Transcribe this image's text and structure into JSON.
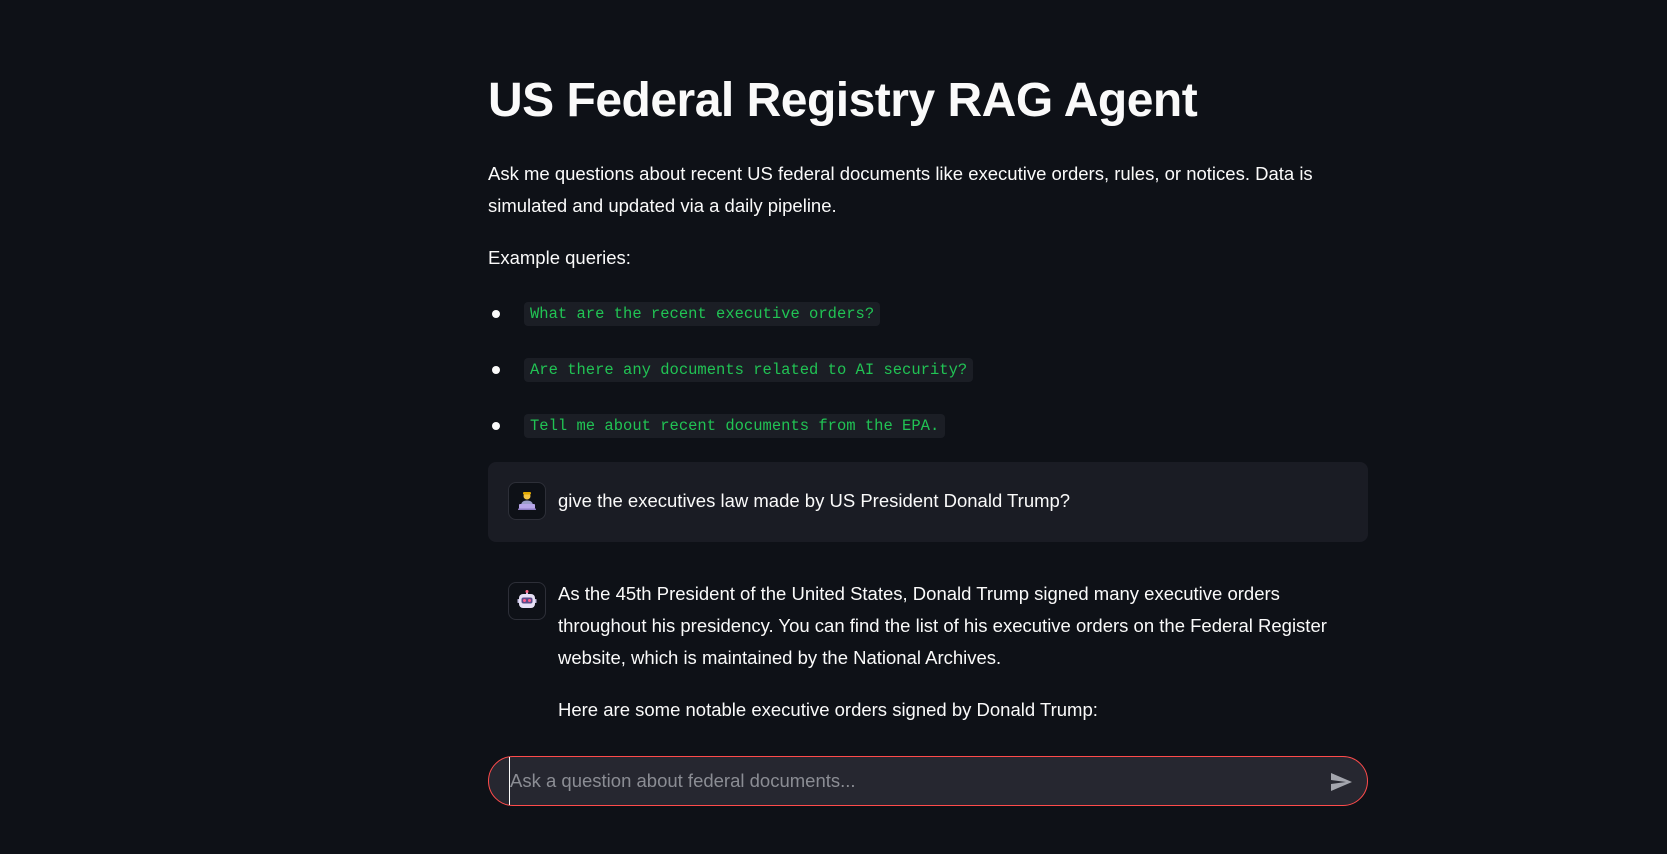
{
  "page": {
    "title": "US Federal Registry RAG Agent",
    "intro": "Ask me questions about recent US federal documents like executive orders, rules, or notices. Data is simulated and updated via a daily pipeline.",
    "examples_label": "Example queries:",
    "examples": [
      "What are the recent executive orders?",
      "Are there any documents related to AI security?",
      "Tell me about recent documents from the EPA."
    ]
  },
  "chat": {
    "messages": [
      {
        "role": "user",
        "avatar_icon": "user-avatar-icon",
        "text": "give the executives law made by US President Donald Trump?"
      },
      {
        "role": "assistant",
        "avatar_icon": "robot-avatar-icon",
        "paragraphs": [
          "As the 45th President of the United States, Donald Trump signed many executive orders throughout his presidency. You can find the list of his executive orders on the Federal Register website, which is maintained by the National Archives.",
          "Here are some notable executive orders signed by Donald Trump:"
        ]
      }
    ],
    "input": {
      "value": "",
      "placeholder": "Ask a question about federal documents...",
      "send_icon": "send-icon"
    }
  },
  "colors": {
    "background": "#0e1117",
    "text": "#fafafa",
    "code_text": "#21c354",
    "code_background": "#1b1e25",
    "user_message_background": "#1a1c24",
    "input_border_focus": "#ff4b4b",
    "input_background": "#262730"
  }
}
